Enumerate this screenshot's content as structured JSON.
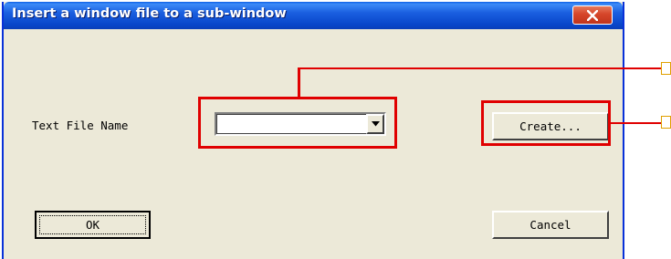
{
  "window": {
    "title": "Insert a window file to a sub-window"
  },
  "form": {
    "text_file_label": "Text File Name",
    "text_file_value": ""
  },
  "buttons": {
    "create_label": "Create...",
    "ok_label": "OK",
    "cancel_label": "Cancel"
  },
  "icons": {
    "close": "close-icon",
    "dropdown": "chevron-down-icon"
  },
  "colors": {
    "annotation": "#e00000",
    "titlebar": "#0845c9",
    "dialog_background": "#ece9d8"
  }
}
